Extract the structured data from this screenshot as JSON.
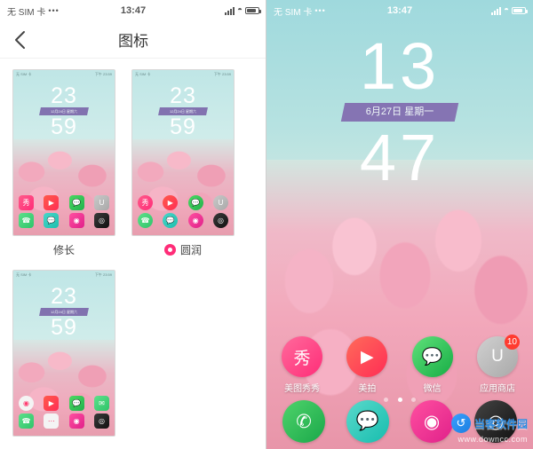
{
  "left": {
    "status": {
      "carrier": "无 SIM 卡",
      "dots": "•••",
      "time": "13:47",
      "signal_icon": "signal-bars-icon",
      "wifi_icon": "wifi-icon",
      "battery_icon": "battery-icon"
    },
    "header": {
      "back_icon": "back-arrow-icon",
      "title": "图标"
    },
    "items": [
      {
        "caption": "修长",
        "selected": false
      },
      {
        "caption": "圆润",
        "selected": true
      },
      {
        "caption": "",
        "selected": false
      }
    ],
    "preview": {
      "time_top": "23",
      "time_bottom": "59",
      "date": "12月24日 星期六",
      "mini_status_left": "无 SIM 卡",
      "mini_status_right": "下午 23:59"
    }
  },
  "right": {
    "status": {
      "carrier": "无 SIM 卡",
      "dots": "•••",
      "time": "13:47",
      "signal_icon": "signal-bars-icon",
      "wifi_icon": "wifi-icon",
      "battery_icon": "battery-icon"
    },
    "clock": {
      "hour": "13",
      "minute": "47",
      "date": "6月27日 星期一"
    },
    "apps": [
      {
        "label": "美图秀秀",
        "icon": "meitu-icon",
        "glyph": "秀",
        "color": "#ff2d78",
        "badge": ""
      },
      {
        "label": "美拍",
        "icon": "meipai-icon",
        "glyph": "▶",
        "color": "#ff2d55",
        "badge": ""
      },
      {
        "label": "微信",
        "icon": "wechat-icon",
        "glyph": "💬",
        "color": "#17ad45",
        "badge": ""
      },
      {
        "label": "应用商店",
        "icon": "appstore-icon",
        "glyph": "U",
        "color": "#a9a9a9",
        "badge": "10"
      }
    ],
    "dock": [
      {
        "label": "",
        "icon": "phone-icon",
        "glyph": "✆",
        "color": "#1aa84a"
      },
      {
        "label": "",
        "icon": "messages-icon",
        "glyph": "💬",
        "color": "#17bdae"
      },
      {
        "label": "",
        "icon": "browser-icon",
        "glyph": "◉",
        "color": "#e0218a"
      },
      {
        "label": "",
        "icon": "camera-icon",
        "glyph": "◎",
        "color": "#111111"
      }
    ],
    "page_dots": {
      "count": 3,
      "active": 1
    }
  },
  "watermark": {
    "icon": "dangbei-logo-icon",
    "glyph": "↺",
    "text": "当客软件园",
    "sub": "www.downcc.com"
  }
}
